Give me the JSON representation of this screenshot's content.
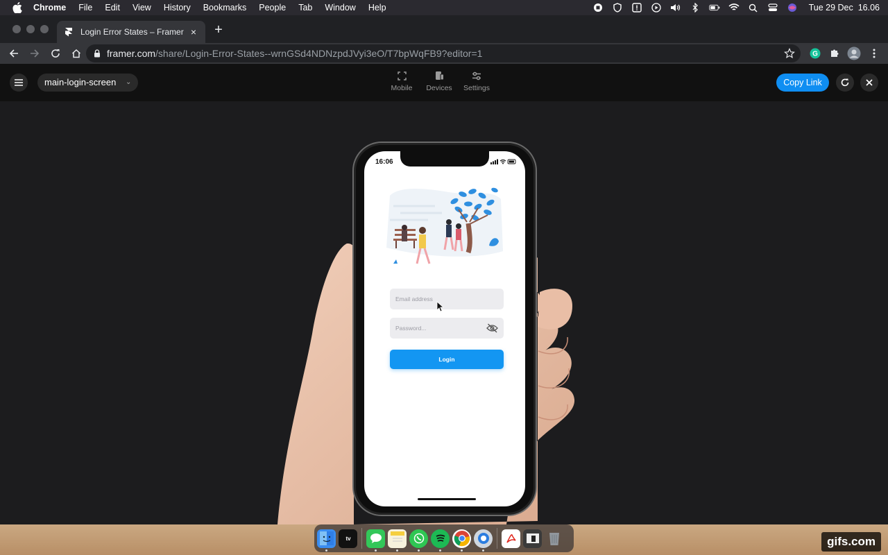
{
  "menubar": {
    "app_name": "Chrome",
    "menus": [
      "File",
      "Edit",
      "View",
      "History",
      "Bookmarks",
      "People",
      "Tab",
      "Window",
      "Help"
    ],
    "clock": "Tue 29 Dec  16.06"
  },
  "browser": {
    "tab_title": "Login Error States – Framer",
    "url_host": "framer.com",
    "url_path": "/share/Login-Error-States--wrnGSd4NDNzpdJVyi3eO/T7bpWqFB9?editor=1"
  },
  "framer": {
    "screen_name": "main-login-screen",
    "tools": [
      {
        "label": "Mobile",
        "icon": "frame-icon"
      },
      {
        "label": "Devices",
        "icon": "devices-icon"
      },
      {
        "label": "Settings",
        "icon": "sliders-icon"
      }
    ],
    "copy_link_label": "Copy Link"
  },
  "phone": {
    "time": "16:06",
    "email_placeholder": "Email address",
    "password_placeholder": "Password...",
    "login_label": "Login"
  },
  "dock": {
    "apps": [
      "Finder",
      "Apple TV",
      "Messages",
      "Notes",
      "WhatsApp",
      "Spotify",
      "Chrome",
      "Screen Recorder",
      "Acrobat",
      "Preview",
      "Trash"
    ]
  },
  "watermark": "gifs.com",
  "colors": {
    "accent": "#0f8ef2",
    "login_button": "#1396f2",
    "canvas": "#1c1c1e",
    "framer_bar": "#111111"
  }
}
